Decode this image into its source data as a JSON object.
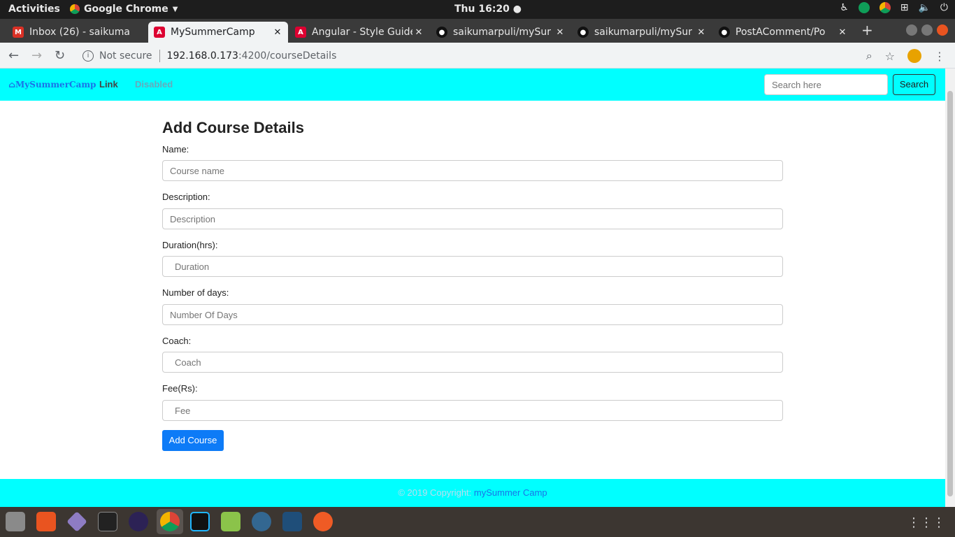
{
  "system": {
    "activities": "Activities",
    "app_name": "Google Chrome",
    "clock": "Thu 16:20"
  },
  "tabs": [
    {
      "title": "Inbox (26) - saikuma",
      "favicon": "gmail-icon"
    },
    {
      "title": "MySummerCamp",
      "favicon": "angular-icon",
      "active": true
    },
    {
      "title": "Angular - Style Guide",
      "favicon": "angular-icon"
    },
    {
      "title": "saikumarpuli/mySur",
      "favicon": "github-icon"
    },
    {
      "title": "saikumarpuli/mySur",
      "favicon": "github-icon"
    },
    {
      "title": "PostAComment/Po",
      "favicon": "github-icon"
    }
  ],
  "address": {
    "security": "Not secure",
    "host": "192.168.0.173",
    "path": ":4200/courseDetails"
  },
  "navbar": {
    "brand": "MySummerCamp",
    "link": "Link",
    "disabled": "Disabled",
    "search_placeholder": "Search here",
    "search_button": "Search"
  },
  "form": {
    "title": "Add Course Details",
    "fields": [
      {
        "label": "Name:",
        "placeholder": "Course name"
      },
      {
        "label": "Description:",
        "placeholder": "Description"
      },
      {
        "label": "Duration(hrs):",
        "placeholder": "Duration"
      },
      {
        "label": "Number of days:",
        "placeholder": "Number Of Days"
      },
      {
        "label": "Coach:",
        "placeholder": "Coach"
      },
      {
        "label": "Fee(Rs):",
        "placeholder": "Fee"
      }
    ],
    "submit": "Add Course"
  },
  "footer": {
    "text": "© 2019 Copyright:",
    "link": "mySummer Camp"
  },
  "colors": {
    "navbar_bg": "#00ffff",
    "primary": "#0d7bf7"
  }
}
